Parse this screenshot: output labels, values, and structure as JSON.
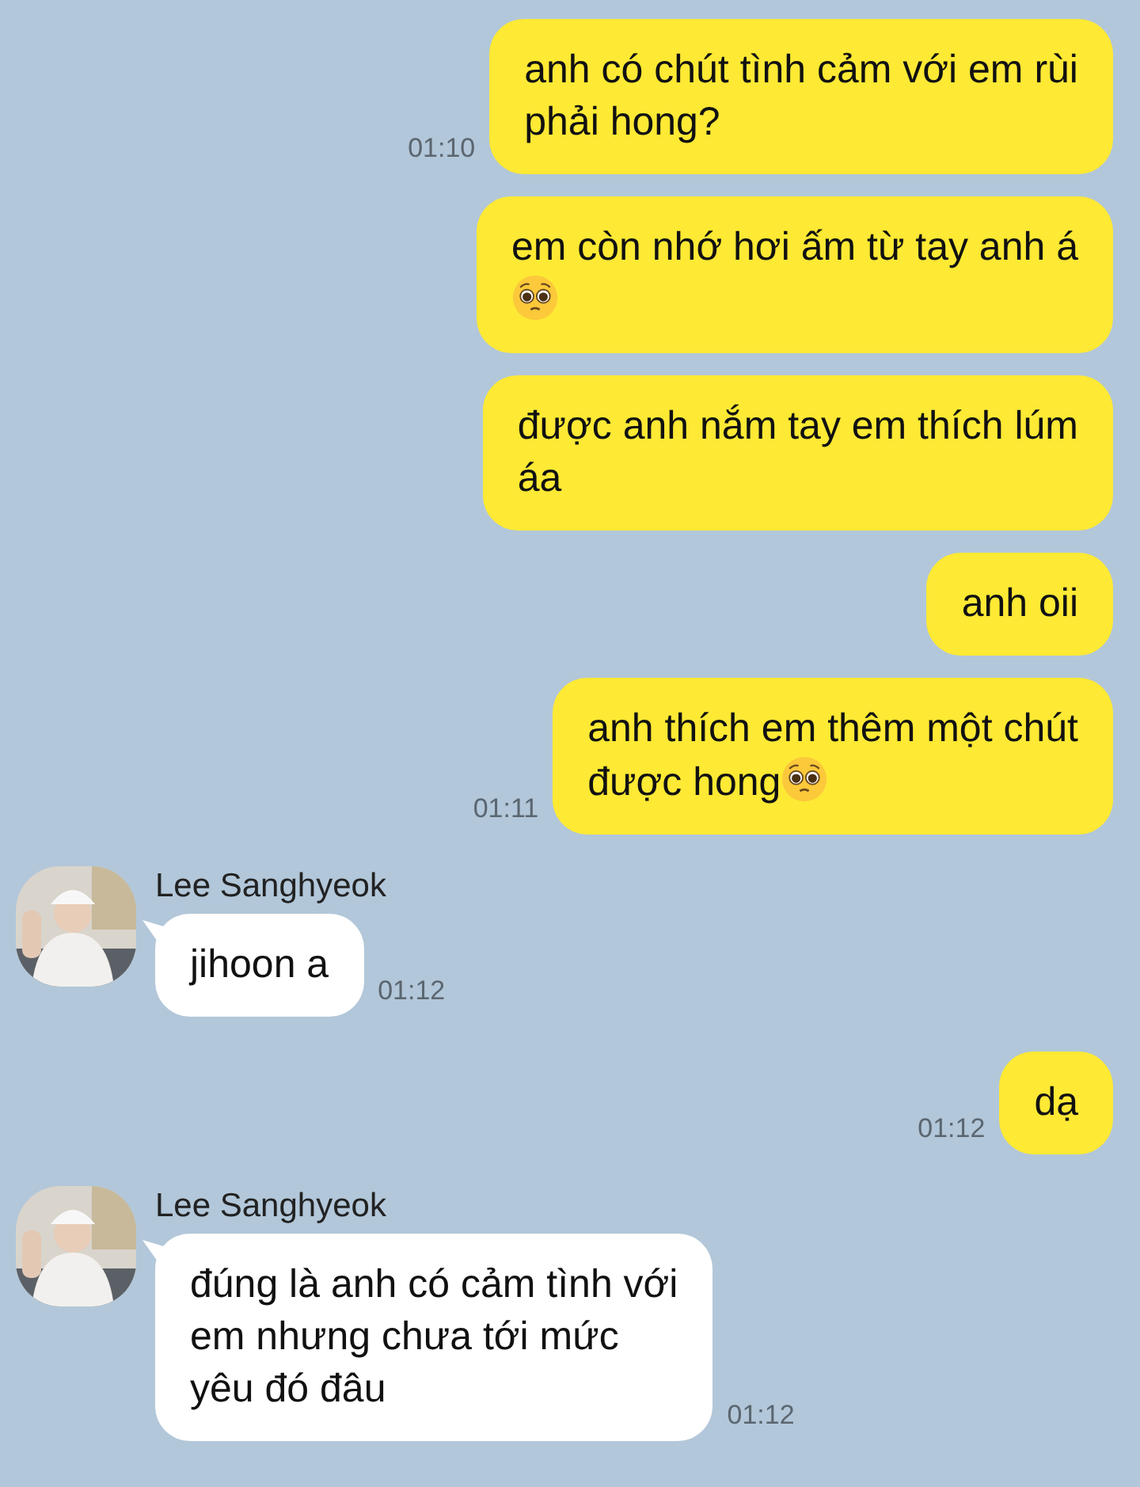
{
  "messages": [
    {
      "kind": "sent",
      "text": "anh có chút tình cảm với em rùi\nphải hong?",
      "time": "01:10"
    },
    {
      "kind": "sent",
      "text": "em còn nhớ hơi ấm từ tay anh á",
      "emoji_below": true
    },
    {
      "kind": "sent",
      "text": "được anh nắm tay em thích lúm\náa"
    },
    {
      "kind": "sent",
      "text": "anh oii"
    },
    {
      "kind": "sent",
      "text": "anh thích em thêm một chút\nđược hong",
      "emoji_after": true,
      "time": "01:11"
    },
    {
      "kind": "received",
      "sender": "Lee Sanghyeok",
      "text": "jihoon a",
      "time": "01:12"
    },
    {
      "kind": "sent",
      "text": "dạ",
      "time": "01:12"
    },
    {
      "kind": "received",
      "sender": "Lee Sanghyeok",
      "text": "đúng là anh có cảm tình với\nem nhưng chưa tới mức\nyêu đó đâu",
      "time": "01:12"
    }
  ]
}
